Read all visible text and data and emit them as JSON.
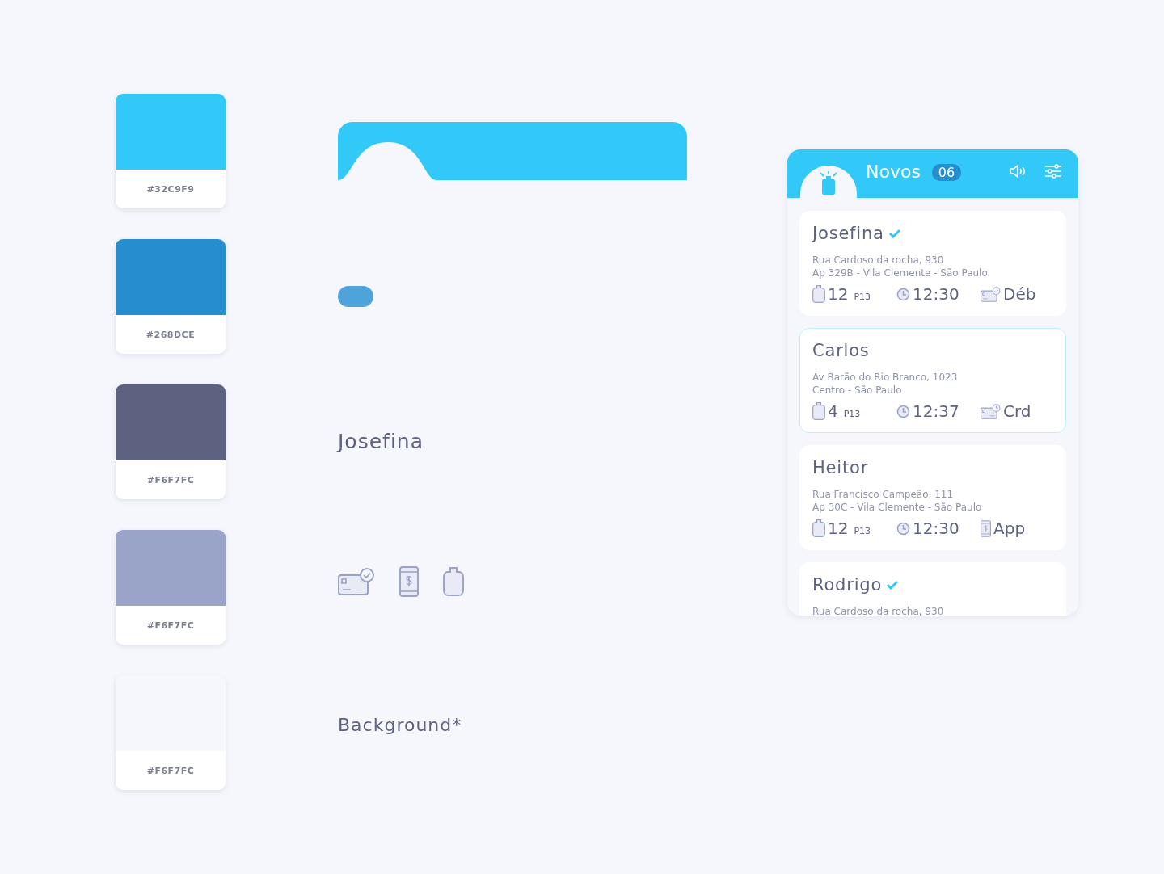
{
  "swatches": [
    {
      "color": "#32C9F9",
      "label": "#32C9F9"
    },
    {
      "color": "#268DCE",
      "label": "#268DCE"
    },
    {
      "color": "#5D6280",
      "label": "#F6F7FC"
    },
    {
      "color": "#9AA3C8",
      "label": "#F6F7FC"
    },
    {
      "color": "#F6F7FC",
      "label": "#F6F7FC"
    }
  ],
  "samples": {
    "name_text": "Josefina",
    "background_text": "Background*",
    "icons": [
      {
        "kind": "card-check"
      },
      {
        "kind": "phone-money"
      },
      {
        "kind": "gas"
      }
    ]
  },
  "panel": {
    "title": "Novos",
    "count": "06",
    "orders": [
      {
        "name": "Josefina",
        "verified": true,
        "selected": false,
        "address": [
          "Rua Cardoso da rocha, 930",
          "Ap 329B - Vila Clemente - São Paulo"
        ],
        "quantity": "12",
        "unit": "P13",
        "time": "12:30",
        "payment": {
          "kind": "card-check",
          "label": "Déb"
        }
      },
      {
        "name": "Carlos",
        "verified": false,
        "selected": true,
        "address": [
          "Av Barão do Rio Branco, 1023",
          "Centro - São Paulo"
        ],
        "quantity": "4",
        "unit": "P13",
        "time": "12:37",
        "payment": {
          "kind": "card-clock",
          "label": "Crd"
        }
      },
      {
        "name": "Heitor",
        "verified": false,
        "selected": false,
        "address": [
          "Rua Francisco Campeão, 111",
          "Ap 30C - Vila Clemente - São Paulo"
        ],
        "quantity": "12",
        "unit": "P13",
        "time": "12:30",
        "payment": {
          "kind": "phone-money",
          "label": "App"
        }
      },
      {
        "name": "Rodrigo",
        "verified": true,
        "selected": false,
        "address": [
          "Rua Cardoso da rocha, 930"
        ]
      }
    ]
  }
}
